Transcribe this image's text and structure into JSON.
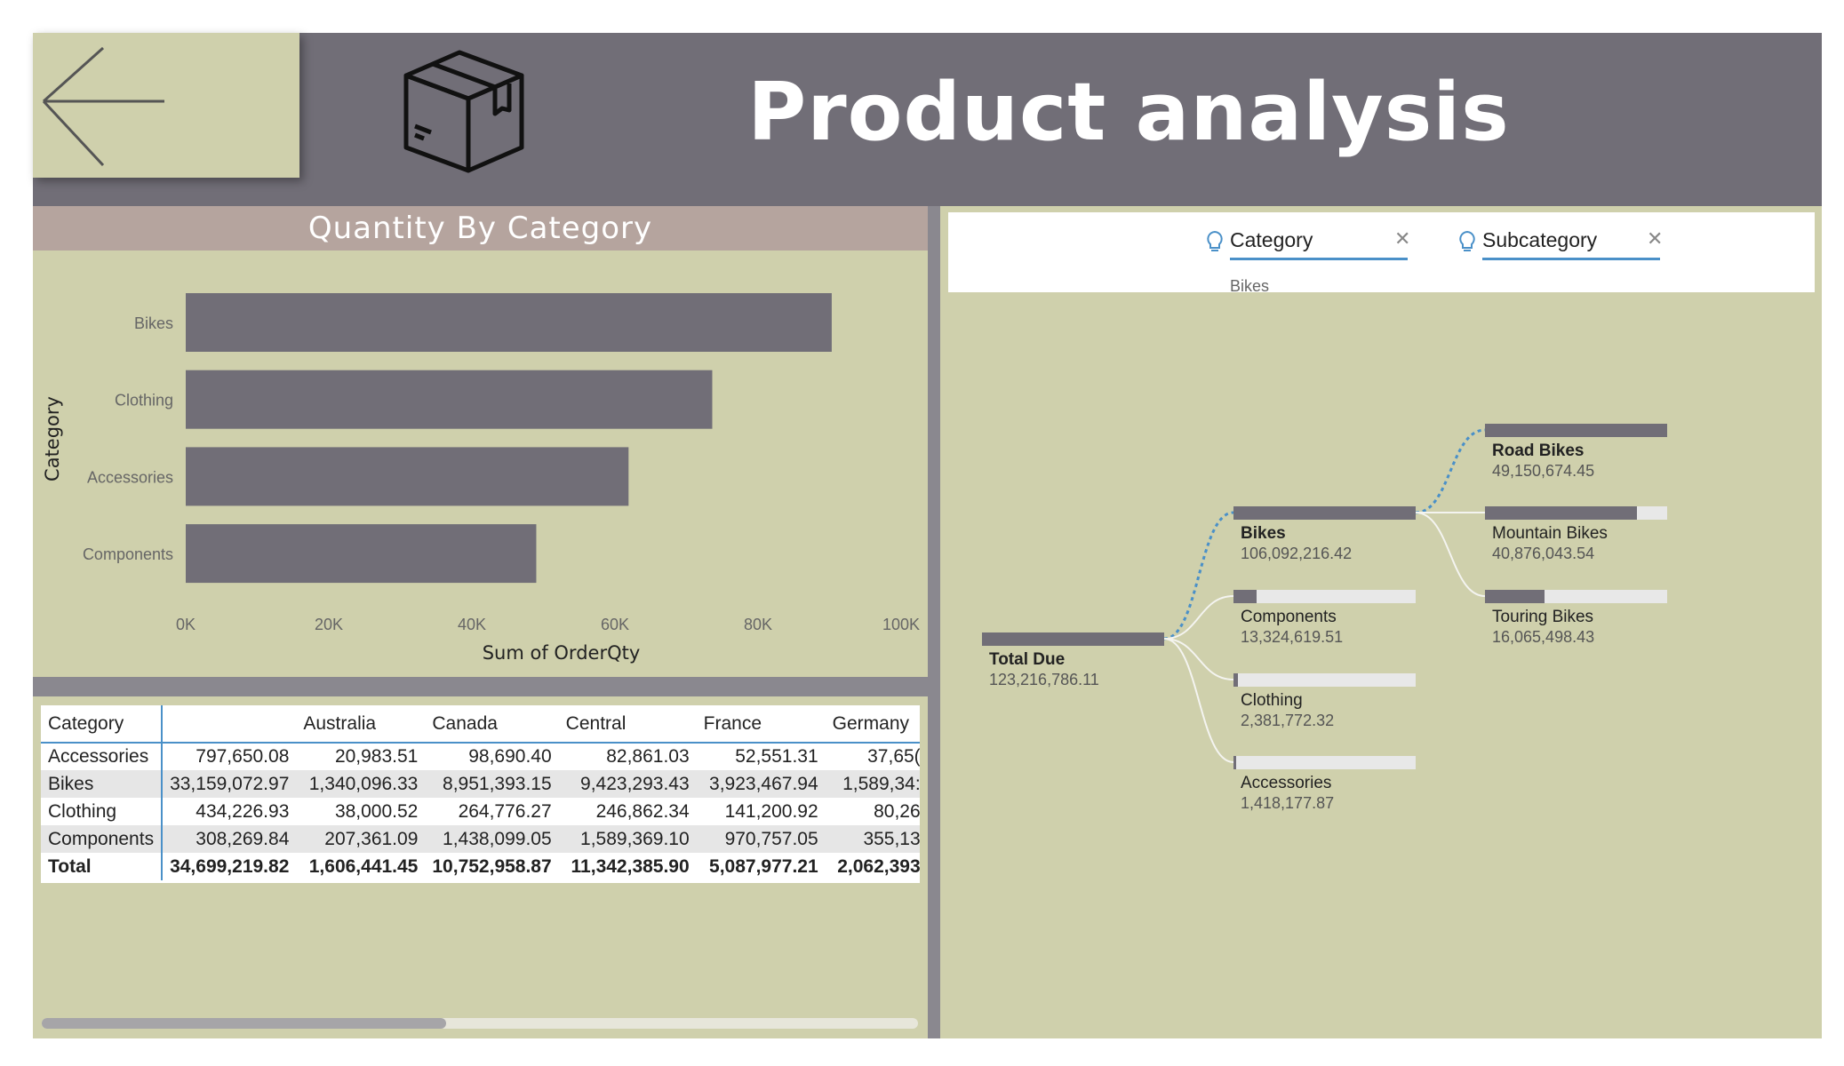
{
  "header": {
    "title": "Product analysis",
    "back_icon": "arrow-left-icon",
    "product_icon": "box-icon"
  },
  "chart_panel": {
    "title": "Quantity By Category"
  },
  "chart_data": {
    "type": "bar",
    "orientation": "horizontal",
    "title": "Quantity By Category",
    "categories": [
      "Bikes",
      "Clothing",
      "Accessories",
      "Components"
    ],
    "values": [
      90300,
      73600,
      61900,
      49000
    ],
    "xlabel": "Sum of OrderQty",
    "ylabel": "Category",
    "xlim": [
      0,
      100000
    ],
    "xticks": [
      "0K",
      "20K",
      "40K",
      "60K",
      "80K",
      "100K"
    ],
    "bar_color": "#716e77",
    "grid": false
  },
  "table": {
    "columns": [
      "Category",
      "",
      "Australia",
      "Canada",
      "Central",
      "France",
      "Germany"
    ],
    "rows": [
      {
        "category": "Accessories",
        "values": [
          "797,650.08",
          "20,983.51",
          "98,690.40",
          "82,861.03",
          "52,551.31",
          "37,65("
        ]
      },
      {
        "category": "Bikes",
        "values": [
          "33,159,072.97",
          "1,340,096.33",
          "8,951,393.15",
          "9,423,293.43",
          "3,923,467.94",
          "1,589,34:"
        ]
      },
      {
        "category": "Clothing",
        "values": [
          "434,226.93",
          "38,000.52",
          "264,776.27",
          "246,862.34",
          "141,200.92",
          "80,26"
        ]
      },
      {
        "category": "Components",
        "values": [
          "308,269.84",
          "207,361.09",
          "1,438,099.05",
          "1,589,369.10",
          "970,757.05",
          "355,13"
        ]
      }
    ],
    "total": {
      "category": "Total",
      "values": [
        "34,699,219.82",
        "1,606,441.45",
        "10,752,958.87",
        "11,342,385.90",
        "5,087,977.21",
        "2,062,393"
      ]
    }
  },
  "decomposition_tree": {
    "levels": [
      {
        "name": "Category",
        "selected": "Bikes"
      },
      {
        "name": "Subcategory",
        "selected": ""
      }
    ],
    "root": {
      "label": "Total Due",
      "value": "123,216,786.11",
      "fraction": 1.0
    },
    "level1": [
      {
        "label": "Bikes",
        "value": "106,092,216.42",
        "fraction": 1.0,
        "selected": true
      },
      {
        "label": "Components",
        "value": "13,324,619.51",
        "fraction": 0.126
      },
      {
        "label": "Clothing",
        "value": "2,381,772.32",
        "fraction": 0.022
      },
      {
        "label": "Accessories",
        "value": "1,418,177.87",
        "fraction": 0.013
      }
    ],
    "level2": [
      {
        "label": "Road Bikes",
        "value": "49,150,674.45",
        "fraction": 1.0,
        "selected": true
      },
      {
        "label": "Mountain Bikes",
        "value": "40,876,043.54",
        "fraction": 0.832
      },
      {
        "label": "Touring Bikes",
        "value": "16,065,498.43",
        "fraction": 0.327
      }
    ],
    "accent_color": "#4a90c8"
  }
}
